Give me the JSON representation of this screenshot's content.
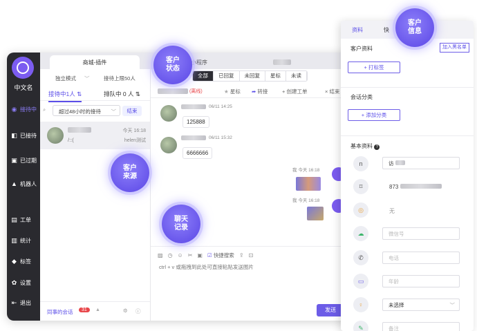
{
  "user": {
    "name": "中文名"
  },
  "sidebar": {
    "items": [
      {
        "label": "接待中",
        "icon": "chat-bubbles-icon",
        "glyph": "◉"
      },
      {
        "label": "已接待",
        "icon": "thumb-icon",
        "glyph": "◧"
      },
      {
        "label": "已过期",
        "icon": "expired-icon",
        "glyph": "▣"
      },
      {
        "label": "机器人",
        "icon": "robot-icon",
        "glyph": "▲"
      },
      {
        "label": "工单",
        "icon": "ticket-icon",
        "glyph": "▤"
      },
      {
        "label": "统计",
        "icon": "stats-icon",
        "glyph": "▥"
      },
      {
        "label": "标签",
        "icon": "tag-icon",
        "glyph": "◆"
      },
      {
        "label": "设置",
        "icon": "gear-icon",
        "glyph": "✿"
      },
      {
        "label": "退出",
        "icon": "exit-icon",
        "glyph": "⇤"
      }
    ]
  },
  "top_tabs": [
    "商城-插件",
    "小程序"
  ],
  "list": {
    "mode": "独立模式",
    "limit": "接待上限50人",
    "tab_serving": "接待中1人",
    "tab_queue": "排队中 0 人",
    "filter": "超过48小时的接待",
    "end": "结束",
    "item": {
      "preview": "/::(",
      "time": "今天 16:18",
      "agent": "helen测试"
    },
    "colleague": "同事的会话",
    "colleague_count": "31"
  },
  "chat": {
    "filters": [
      "全部",
      "已回复",
      "未回复",
      "星标",
      "未读"
    ],
    "tag_red": "离线",
    "actions": {
      "star": "星标",
      "transfer": "转接",
      "create_ticket": "创建工单",
      "end": "结束"
    },
    "messages": [
      {
        "time": "06/11 14:25",
        "text": "125888"
      },
      {
        "time": "06/11 15:32",
        "text": "6666666"
      }
    ],
    "self_label": "我",
    "self_time": "今天 16:18",
    "quick_search": "快捷搜索",
    "hint": "ctrl + v 或拖拽到此处可直接粘贴发送图片",
    "send": "发送"
  },
  "info": {
    "tabs": [
      "资料",
      "快"
    ],
    "section_customer": "客户资料",
    "blacklist": "加入黑名单",
    "add_tag": "+ 打标签",
    "section_category": "会话分类",
    "add_category": "+ 添加分类",
    "section_basic": "基本资料",
    "fields": {
      "name_value": "访",
      "id_value": "873",
      "none": "无",
      "wechat": "微信号",
      "phone": "电话",
      "age": "年龄",
      "gender": "未选择",
      "remark": "备注"
    }
  },
  "callouts": {
    "customer_status": "客户\n状态",
    "customer_info": "客户\n信息",
    "customer_source": "客户\n来源",
    "chat_history": "聊天\n记录"
  }
}
